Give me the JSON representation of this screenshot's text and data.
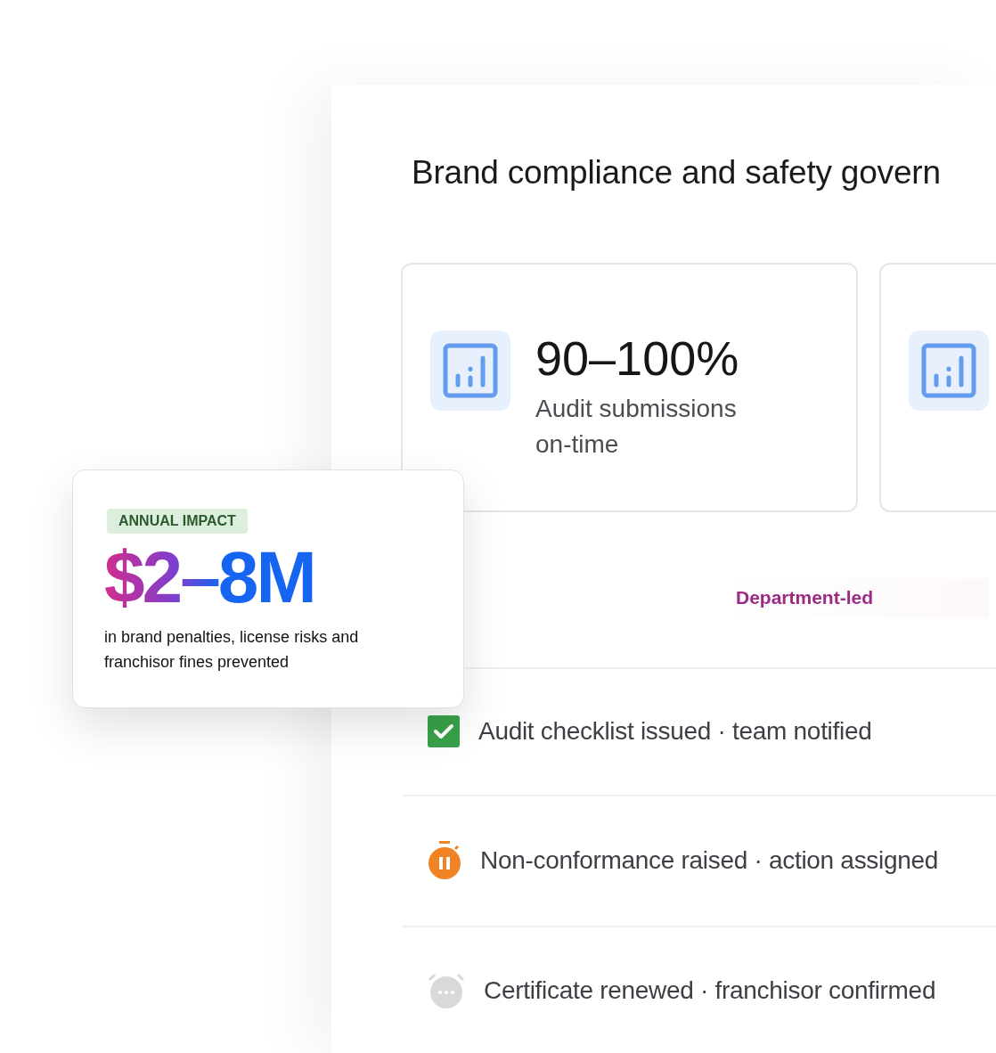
{
  "panel": {
    "title": "Brand compliance and safety govern"
  },
  "metric_cards": [
    {
      "kind": "full",
      "value": "90–100%",
      "label": "Audit submissions on-time"
    },
    {
      "kind": "partial"
    }
  ],
  "mode_label": "Department-led",
  "status_rows": [
    {
      "kind": "done",
      "text": "Audit checklist issued · team notified"
    },
    {
      "kind": "paused",
      "text": "Non-conformance raised · action assigned"
    },
    {
      "kind": "pending",
      "text": "Certificate renewed · franchisor confirmed"
    }
  ],
  "impact_card": {
    "badge": "ANNUAL IMPACT",
    "amount": "$2–8M",
    "description": "in brand penalties, license risks and franchisor fines prevented"
  }
}
